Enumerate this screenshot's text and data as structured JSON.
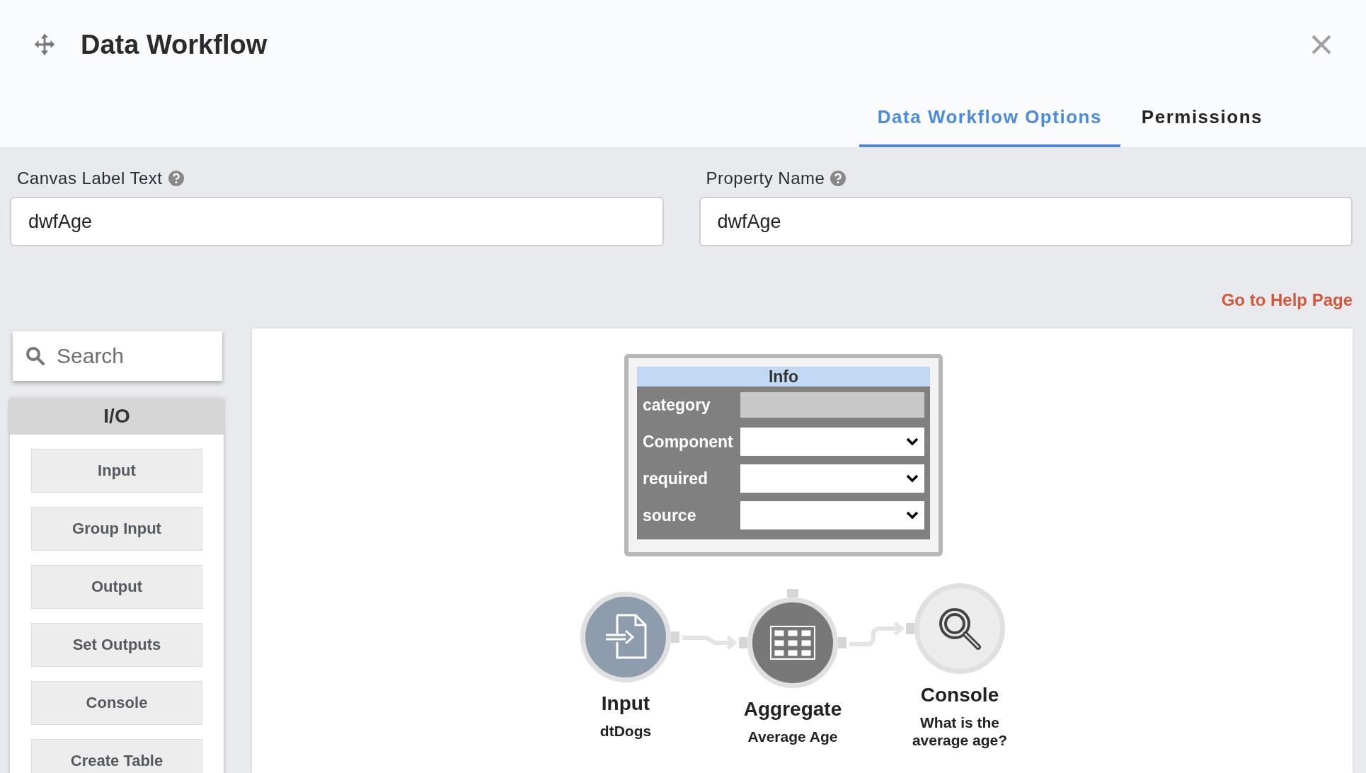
{
  "dialog": {
    "title": "Data Workflow",
    "tabs": [
      {
        "label": "Data Workflow Options",
        "selected": true
      },
      {
        "label": "Permissions",
        "selected": false
      }
    ],
    "fields": [
      {
        "label": "Canvas Label Text",
        "value": "dwfAge"
      },
      {
        "label": "Property Name",
        "value": "dwfAge"
      }
    ],
    "help_link": "Go to Help Page",
    "palette": {
      "search": {
        "placeholder": "Search"
      },
      "group": "I/O",
      "items": [
        "Input",
        "Group Input",
        "Output",
        "Set Outputs",
        "Console",
        "Create Table"
      ]
    },
    "info_panel": {
      "title": "Info",
      "rows": [
        {
          "label": "category",
          "kind": "readonly"
        },
        {
          "label": "Component",
          "kind": "select"
        },
        {
          "label": "required",
          "kind": "select"
        },
        {
          "label": "source",
          "kind": "select"
        }
      ]
    },
    "nodes": [
      {
        "kind": "input",
        "title": "Input",
        "subtitle": "dtDogs"
      },
      {
        "kind": "aggregate",
        "title": "Aggregate",
        "subtitle": "Average Age"
      },
      {
        "kind": "console",
        "title": "Console",
        "subtitle": "What is the average age?"
      }
    ]
  }
}
